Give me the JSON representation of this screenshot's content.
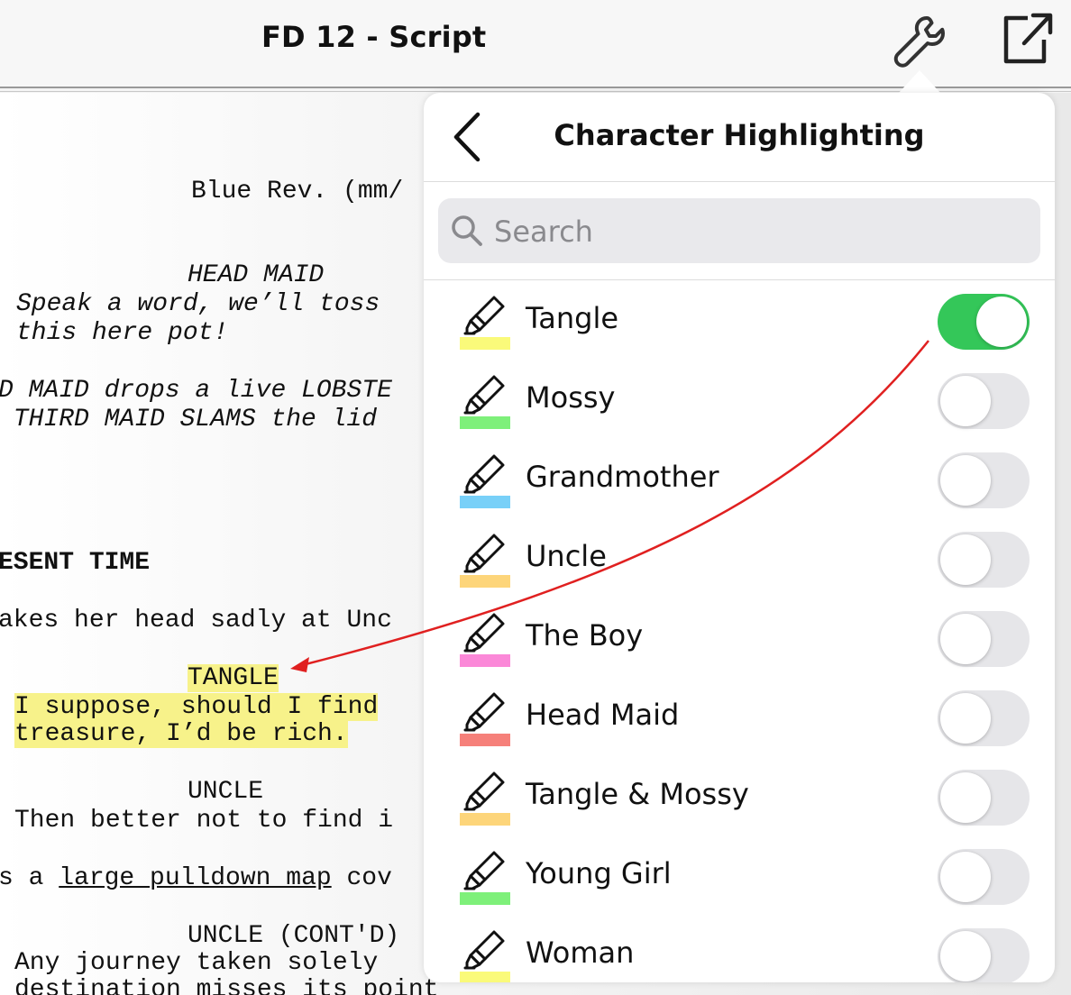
{
  "header": {
    "title": "FD 12 - Script",
    "tools_icon": "wrench-icon",
    "share_icon": "share-icon"
  },
  "script": {
    "rev": "Blue Rev. (mm/",
    "char1": "HEAD MAID",
    "dlg1a": "Speak a word, we’ll toss",
    "dlg1b": "this here pot!",
    "act1a": "D MAID drops a live LOBSTE",
    "act1b": " THIRD MAID SLAMS the lid",
    "scene": "ESENT TIME",
    "act2": "akes her head sadly at Unc",
    "char2": "TANGLE",
    "dlg2a": "I suppose, should I find",
    "dlg2b": "treasure, I’d be rich.",
    "char3": "UNCLE",
    "dlg3": "Then better not to find i",
    "act3a": "s a ",
    "act3b": "large pulldown map",
    "act3c": " cov",
    "char4": "UNCLE (CONT'D)",
    "dlg4a": "Any journey taken solely",
    "dlg4b": "destination misses its point"
  },
  "popover": {
    "title": "Character Highlighting",
    "back_icon": "chevron-left-icon",
    "search_placeholder": "Search",
    "search_value": "",
    "characters": [
      {
        "name": "Tangle",
        "color": "#fafa7a",
        "enabled": true
      },
      {
        "name": "Mossy",
        "color": "#7ef07a",
        "enabled": false
      },
      {
        "name": "Grandmother",
        "color": "#78d0f8",
        "enabled": false
      },
      {
        "name": "Uncle",
        "color": "#fdd57a",
        "enabled": false
      },
      {
        "name": "The Boy",
        "color": "#fb88d8",
        "enabled": false
      },
      {
        "name": "Head Maid",
        "color": "#f6807a",
        "enabled": false
      },
      {
        "name": "Tangle & Mossy",
        "color": "#fdd57a",
        "enabled": false
      },
      {
        "name": "Young Girl",
        "color": "#7ef07a",
        "enabled": false
      },
      {
        "name": "Woman",
        "color": "#fafa7a",
        "enabled": false
      }
    ]
  },
  "colors": {
    "toggle_on": "#34c759",
    "annotation_arrow": "#e02020"
  }
}
